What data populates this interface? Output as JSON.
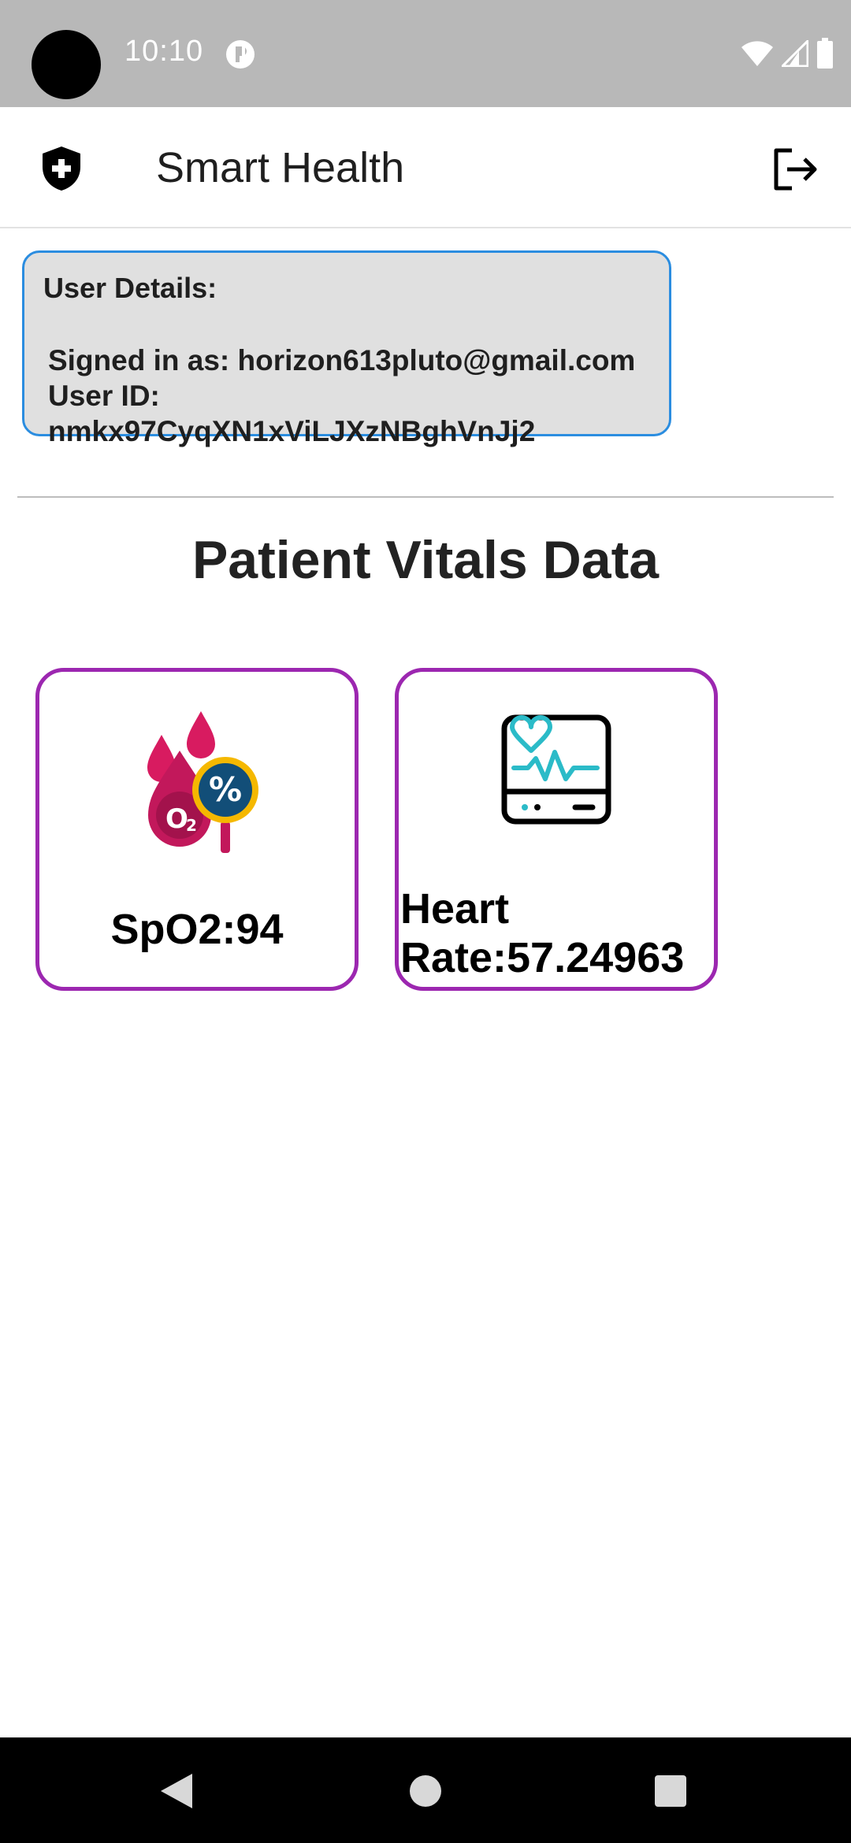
{
  "status_bar": {
    "time": "10:10"
  },
  "app_bar": {
    "title": "Smart Health",
    "logo_icon": "shield-plus-icon",
    "logout_icon": "logout-icon"
  },
  "user_details": {
    "heading": "User Details:",
    "signed_in_line": "Signed in as: horizon613pluto@gmail.com",
    "user_id_line": "User ID: nmkx97CyqXN1xViLJXzNBghVnJj2"
  },
  "section_title": "Patient Vitals Data",
  "vitals": [
    {
      "label": "SpO2:94",
      "icon": "blood-oxygen-icon"
    },
    {
      "label": "Heart Rate:57.24963",
      "icon": "heart-monitor-icon"
    }
  ],
  "colors": {
    "card_border": "#9c27b0",
    "user_card_border": "#2b8de0",
    "status_bar": "#b8b8b8"
  }
}
